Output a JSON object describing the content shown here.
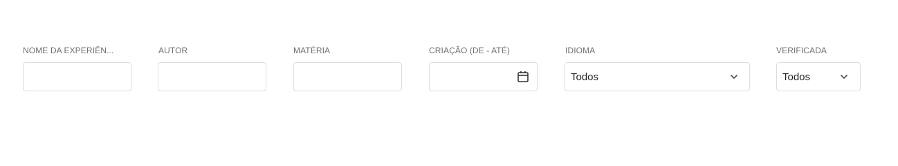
{
  "filters": {
    "experience_name": {
      "label": "NOME DA EXPERIÊN...",
      "value": ""
    },
    "author": {
      "label": "AUTOR",
      "value": ""
    },
    "subject": {
      "label": "MATÉRIA",
      "value": ""
    },
    "creation_date": {
      "label": "CRIAÇÃO (DE - ATÉ)",
      "value": "",
      "icon": "calendar-icon"
    },
    "language": {
      "label": "IDIOMA",
      "selected": "Todos",
      "icon": "chevron-down-icon"
    },
    "verified": {
      "label": "VERIFICADA",
      "selected": "Todos",
      "icon": "chevron-down-icon"
    }
  },
  "colors": {
    "label": "#6f6f6f",
    "border": "#d9dde3",
    "text": "#222222"
  }
}
